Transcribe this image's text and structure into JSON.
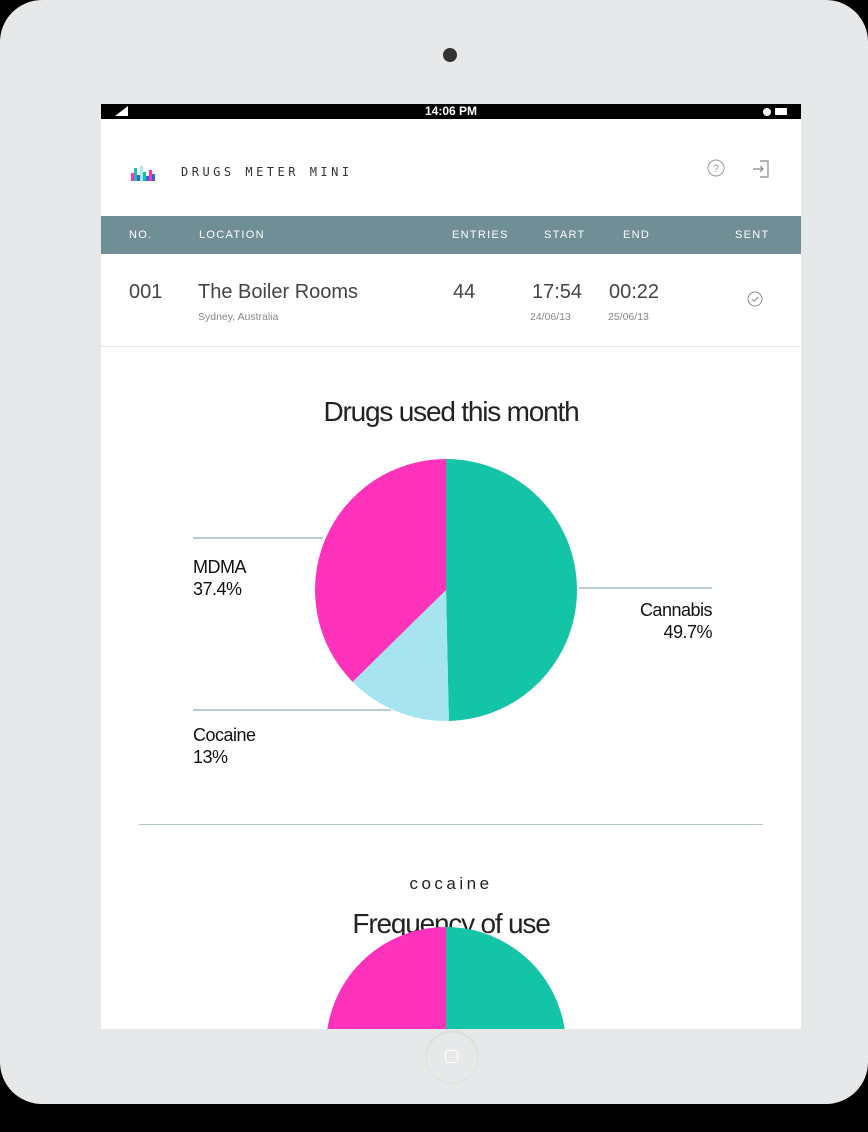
{
  "status_bar": {
    "time": "14:06 PM"
  },
  "app": {
    "title": "DRUGS METER MINI"
  },
  "table": {
    "headers": {
      "no": "NO.",
      "location": "LOCATION",
      "entries": "ENTRIES",
      "start": "START",
      "end": "END",
      "sent": "SENT"
    },
    "rows": [
      {
        "no": "001",
        "location": "The Boiler Rooms",
        "city": "Sydney, Australia",
        "entries": "44",
        "start_time": "17:54",
        "start_date": "24/06/13",
        "end_time": "00:22",
        "end_date": "25/06/13"
      }
    ]
  },
  "chart1": {
    "title": "Drugs used this month",
    "labels": {
      "mdma": {
        "name": "MDMA",
        "pct": "37.4%"
      },
      "cannabis": {
        "name": "Cannabis",
        "pct": "49.7%"
      },
      "cocaine": {
        "name": "Cocaine",
        "pct": "13%"
      }
    }
  },
  "chart2": {
    "subtitle": "cocaine",
    "title": "Frequency of use"
  },
  "colors": {
    "cannabis": "#14c4a6",
    "mdma": "#ff33bb",
    "cocaine": "#a6e4f0",
    "header": "#6f8e95"
  },
  "chart_data": [
    {
      "type": "pie",
      "title": "Drugs used this month",
      "categories": [
        "Cannabis",
        "Cocaine",
        "MDMA"
      ],
      "values": [
        49.7,
        13,
        37.4
      ]
    },
    {
      "type": "pie",
      "title": "Frequency of use",
      "subtitle": "cocaine",
      "categories": [
        "",
        ""
      ],
      "values": [
        50,
        50
      ]
    }
  ]
}
